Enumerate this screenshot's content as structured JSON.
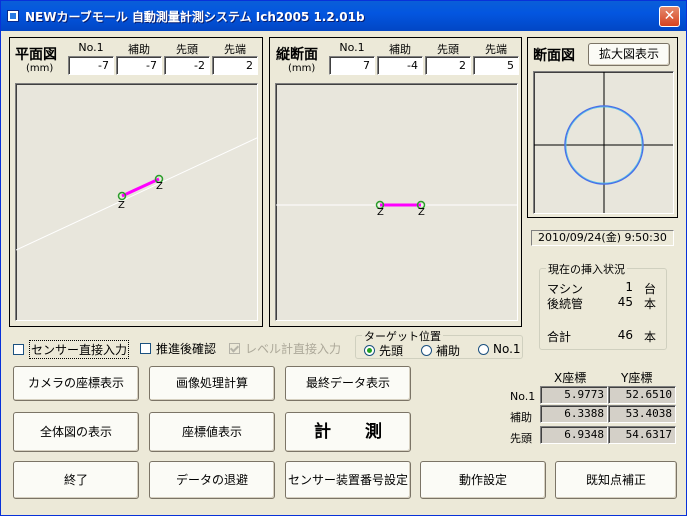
{
  "window": {
    "title": "NEWカーブモール 自動測量計測システム Ich2005 1.2.01b",
    "close_label": "✕"
  },
  "plan_view": {
    "title": "平面図",
    "unit": "(mm)",
    "columns": [
      {
        "label": "No.1",
        "value": "-7"
      },
      {
        "label": "補助",
        "value": "-7"
      },
      {
        "label": "先頭",
        "value": "-2"
      },
      {
        "label": "先端",
        "value": "2"
      }
    ],
    "marker_label": "Z"
  },
  "profile_view": {
    "title": "縦断面",
    "unit": "(mm)",
    "columns": [
      {
        "label": "No.1",
        "value": "7"
      },
      {
        "label": "補助",
        "value": "-4"
      },
      {
        "label": "先頭",
        "value": "2"
      },
      {
        "label": "先端",
        "value": "5"
      }
    ],
    "marker_label": "Z"
  },
  "section_view": {
    "title": "断面図",
    "enlarge_button": "拡大図表示"
  },
  "datetime": "2010/09/24(金) 9:50:30",
  "insertion_status": {
    "title": "現在の挿入状況",
    "rows": [
      {
        "label": "マシン",
        "count": "1",
        "unit": "台"
      },
      {
        "label": "後続管",
        "count": "45",
        "unit": "本"
      },
      {
        "label": "合計",
        "count": "46",
        "unit": "本"
      }
    ]
  },
  "options": {
    "sensor_direct": "センサー直接入力",
    "thrust_confirm": "推進後確認",
    "level_direct": "レベル計直接入力"
  },
  "target_position": {
    "title": "ターゲット位置",
    "options": [
      "先頭",
      "補助",
      "No.1"
    ],
    "selected": "先頭"
  },
  "coordinates": {
    "x_header": "X座標",
    "y_header": "Y座標",
    "rows": [
      {
        "label": "No.1",
        "x": "5.9773",
        "y": "52.6510"
      },
      {
        "label": "補助",
        "x": "6.3388",
        "y": "53.4038"
      },
      {
        "label": "先頭",
        "x": "6.9348",
        "y": "54.6317"
      }
    ]
  },
  "buttons": {
    "camera_coords": "カメラの座標表示",
    "image_calc": "画像処理計算",
    "final_data": "最終データ表示",
    "overall_view": "全体図の表示",
    "coord_values": "座標値表示",
    "measure": "計　　測",
    "exit": "終了",
    "save_data": "データの退避",
    "sensor_number": "センサー装置番号設定",
    "operation_settings": "動作設定",
    "known_point": "既知点補正"
  }
}
